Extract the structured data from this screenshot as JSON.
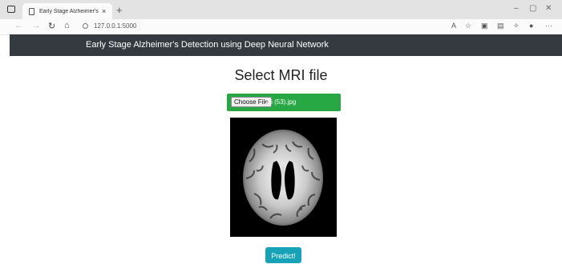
{
  "browser": {
    "tab_title": "Early Stage Alzheimer's Detectio",
    "tab_close": "×",
    "new_tab": "+",
    "url": "127.0.0.1:5000",
    "controls": {
      "minimize": "–",
      "restore": "▢",
      "close": "✕"
    },
    "toolbar_icons": [
      "read-aloud-icon",
      "favorites-icon",
      "collections-icon",
      "wallet-icon",
      "extensions-icon",
      "profile-icon",
      "more-icon"
    ]
  },
  "navbar": {
    "title": "Early Stage Alzheimer's Detection using Deep Neural Network"
  },
  "main": {
    "heading": "Select MRI file",
    "file_input": {
      "button_label": "Choose File",
      "filename": "26 (53).jpg"
    },
    "predict_label": "Predict!"
  },
  "colors": {
    "navbar": "#343a40",
    "file_bar": "#28a745",
    "predict": "#17a2b8"
  }
}
